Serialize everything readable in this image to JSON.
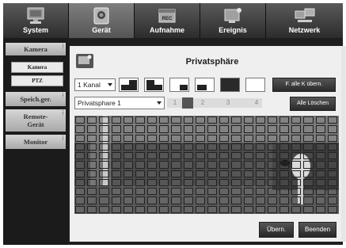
{
  "tabs": [
    {
      "label": "System",
      "icon": "monitor-icon",
      "active": false
    },
    {
      "label": "Gerät",
      "icon": "camera-icon",
      "active": true
    },
    {
      "label": "Aufnahme",
      "icon": "recording-icon",
      "active": false
    },
    {
      "label": "Ereignis",
      "icon": "event-icon",
      "active": false
    },
    {
      "label": "Netzwerk",
      "icon": "network-icon",
      "active": false
    }
  ],
  "sidebar": {
    "items": [
      {
        "label": "Kamera",
        "sub": [
          "Kamera",
          "PTZ"
        ]
      },
      {
        "label": "Speich.ger."
      },
      {
        "label": "Remote-Gerät"
      },
      {
        "label": "Monitor"
      }
    ]
  },
  "panel": {
    "title": "Privatsphäre",
    "channel_select": "1 Kanal",
    "privacy_select": "Privatsphare 1",
    "copy_all_button": "F. alle K übern.",
    "clear_all_button": "Alle Löschen",
    "numbers": [
      "1",
      "2",
      "3",
      "4"
    ],
    "active_number": "2"
  },
  "footer": {
    "apply_button": "Übern.",
    "exit_button": "Beenden"
  },
  "colors": {
    "accent": "#555555",
    "panel_bg": "#efefef",
    "bar_dark": "#2c2c2c"
  }
}
